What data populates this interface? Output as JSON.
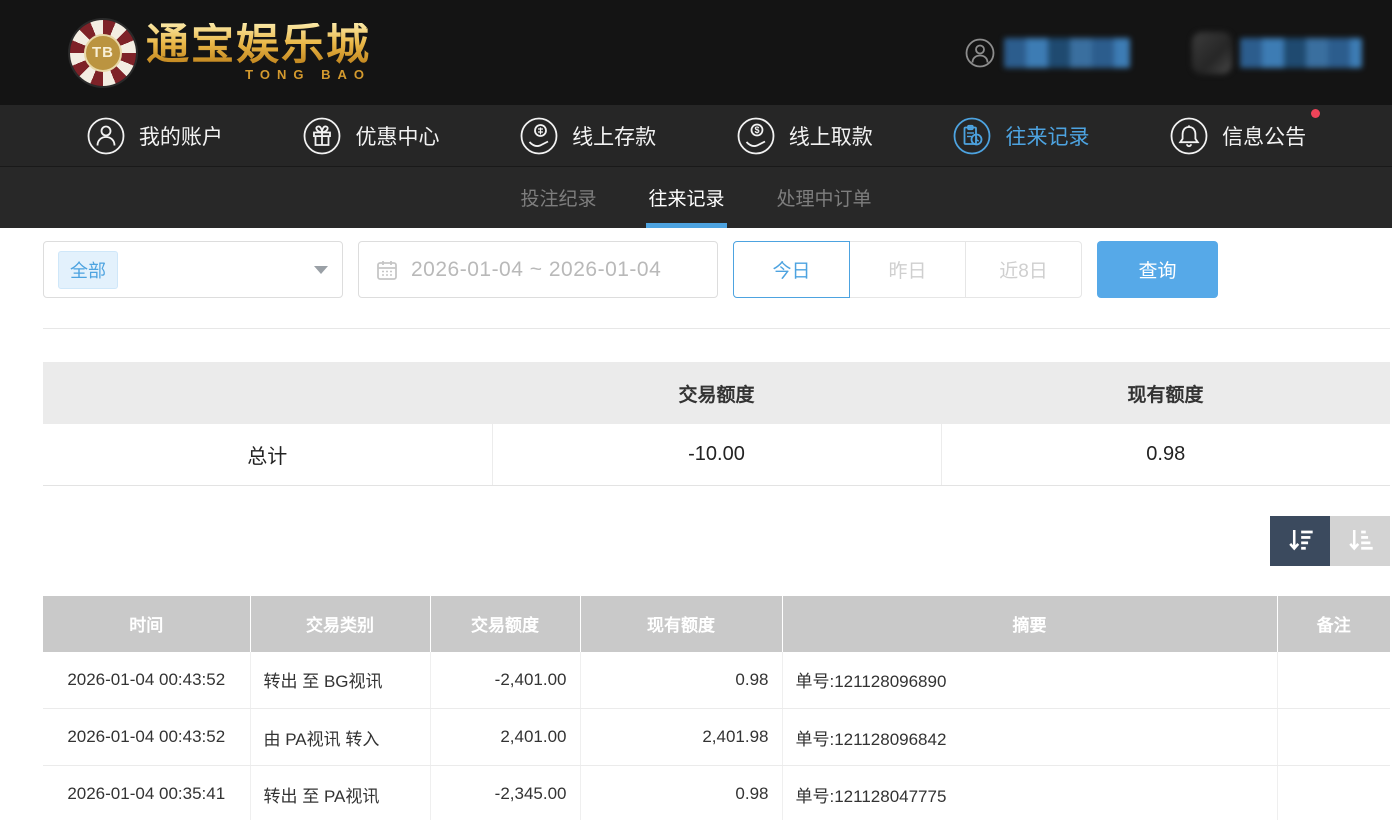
{
  "brand": {
    "logo_tb": "TB",
    "name_cn": "通宝娱乐城",
    "name_en": "TONG BAO"
  },
  "nav": {
    "items": [
      {
        "label": "我的账户",
        "icon": "account-icon",
        "active": false
      },
      {
        "label": "优惠中心",
        "icon": "gift-icon",
        "active": false
      },
      {
        "label": "线上存款",
        "icon": "deposit-icon",
        "active": false
      },
      {
        "label": "线上取款",
        "icon": "withdraw-icon",
        "active": false
      },
      {
        "label": "往来记录",
        "icon": "records-icon",
        "active": true
      },
      {
        "label": "信息公告",
        "icon": "bell-icon",
        "active": false,
        "has_red_dot": true
      }
    ]
  },
  "subnav": {
    "tabs": [
      {
        "label": "投注纪录",
        "active": false
      },
      {
        "label": "往来记录",
        "active": true
      },
      {
        "label": "处理中订单",
        "active": false
      }
    ]
  },
  "filters": {
    "type_selected": "全部",
    "date_range": "2026-01-04 ~ 2026-01-04",
    "quick_buttons": [
      "今日",
      "昨日",
      "近8日"
    ],
    "active_quick": "今日",
    "search_label": "查询"
  },
  "summary": {
    "headers": [
      "",
      "交易额度",
      "现有额度"
    ],
    "row": {
      "label": "总计",
      "amount": "-10.00",
      "balance": "0.98"
    }
  },
  "table": {
    "headers": [
      "时间",
      "交易类别",
      "交易额度",
      "现有额度",
      "摘要",
      "备注"
    ],
    "rows": [
      [
        "2026-01-04 00:43:52",
        "转出 至 BG视讯",
        "-2,401.00",
        "0.98",
        "单号:121128096890",
        ""
      ],
      [
        "2026-01-04 00:43:52",
        "由 PA视讯 转入",
        "2,401.00",
        "2,401.98",
        "单号:121128096842",
        ""
      ],
      [
        "2026-01-04 00:35:41",
        "转出 至 PA视讯",
        "-2,345.00",
        "0.98",
        "单号:121128047775",
        ""
      ]
    ]
  },
  "colors": {
    "accent_blue": "#4da3e0",
    "search_button_blue": "#56a9e8",
    "sort_active_bg": "#3b4a5e",
    "sort_inactive_bg": "#d3d3d3",
    "notification_red": "#ef4459",
    "brand_gold": "#e2a93e",
    "table_header_gray": "#c9c9c9",
    "summary_header_gray": "#ebebeb"
  }
}
